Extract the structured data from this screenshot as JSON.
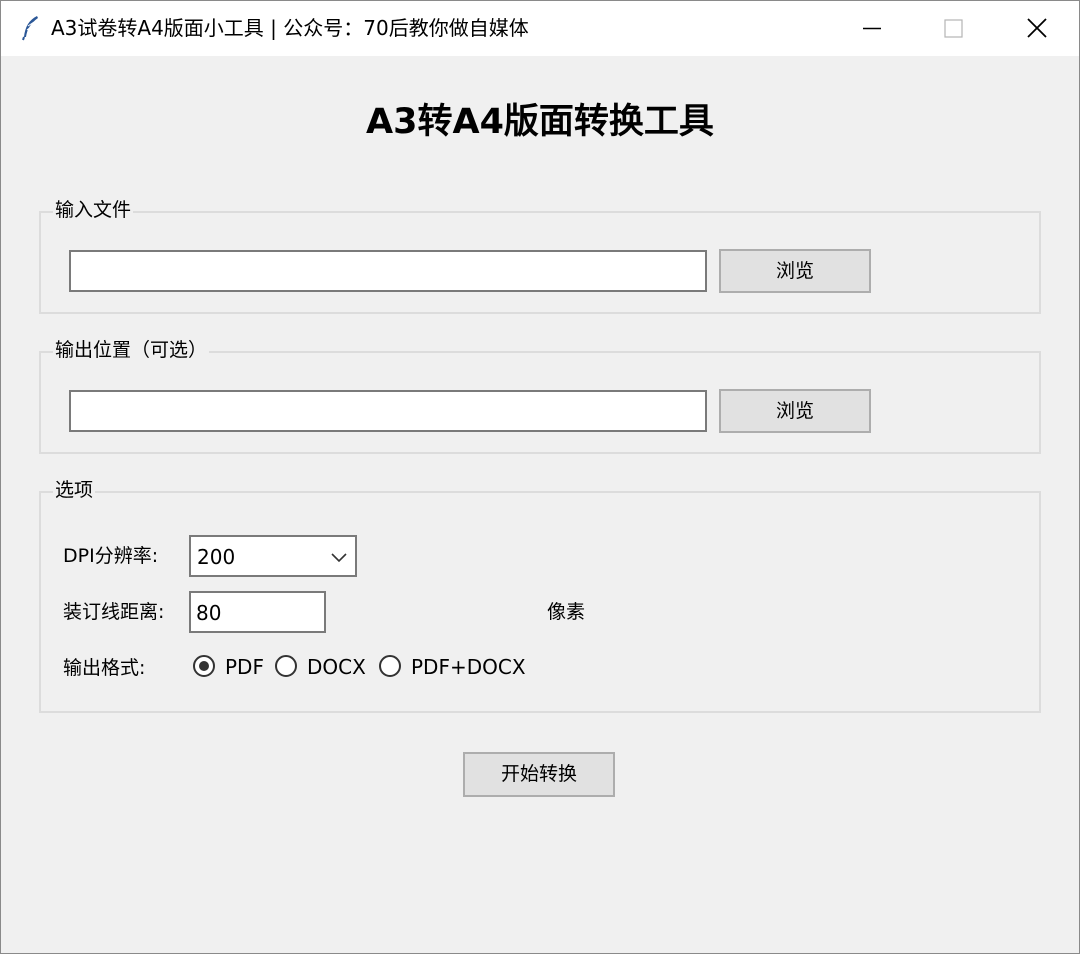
{
  "window": {
    "title": "A3试卷转A4版面小工具 | 公众号：70后教你做自媒体",
    "icon": "feather-icon",
    "controls": [
      "minimize-icon",
      "maximize-icon",
      "close-icon"
    ]
  },
  "main": {
    "heading": "A3转A4版面转换工具"
  },
  "input_group": {
    "legend": "输入文件",
    "path_value": "",
    "browse_label": "浏览"
  },
  "output_group": {
    "legend": "输出位置（可选）",
    "path_value": "",
    "browse_label": "浏览"
  },
  "options": {
    "legend": "选项",
    "dpi_label": "DPI分辨率:",
    "dpi_value": "200",
    "margin_label": "装订线距离:",
    "margin_value": "80",
    "margin_unit": "像素",
    "format_label": "输出格式:",
    "formats": [
      {
        "label": "PDF",
        "selected": true
      },
      {
        "label": "DOCX",
        "selected": false
      },
      {
        "label": "PDF+DOCX",
        "selected": false
      }
    ]
  },
  "actions": {
    "start_label": "开始转换"
  },
  "colors": {
    "window_bg": "#f0f0f0",
    "titlebar_bg": "#ffffff",
    "button_bg": "#e1e1e1",
    "button_border": "#adadad",
    "group_border": "#dcdcdc",
    "icon_blue": "#2b5797"
  }
}
